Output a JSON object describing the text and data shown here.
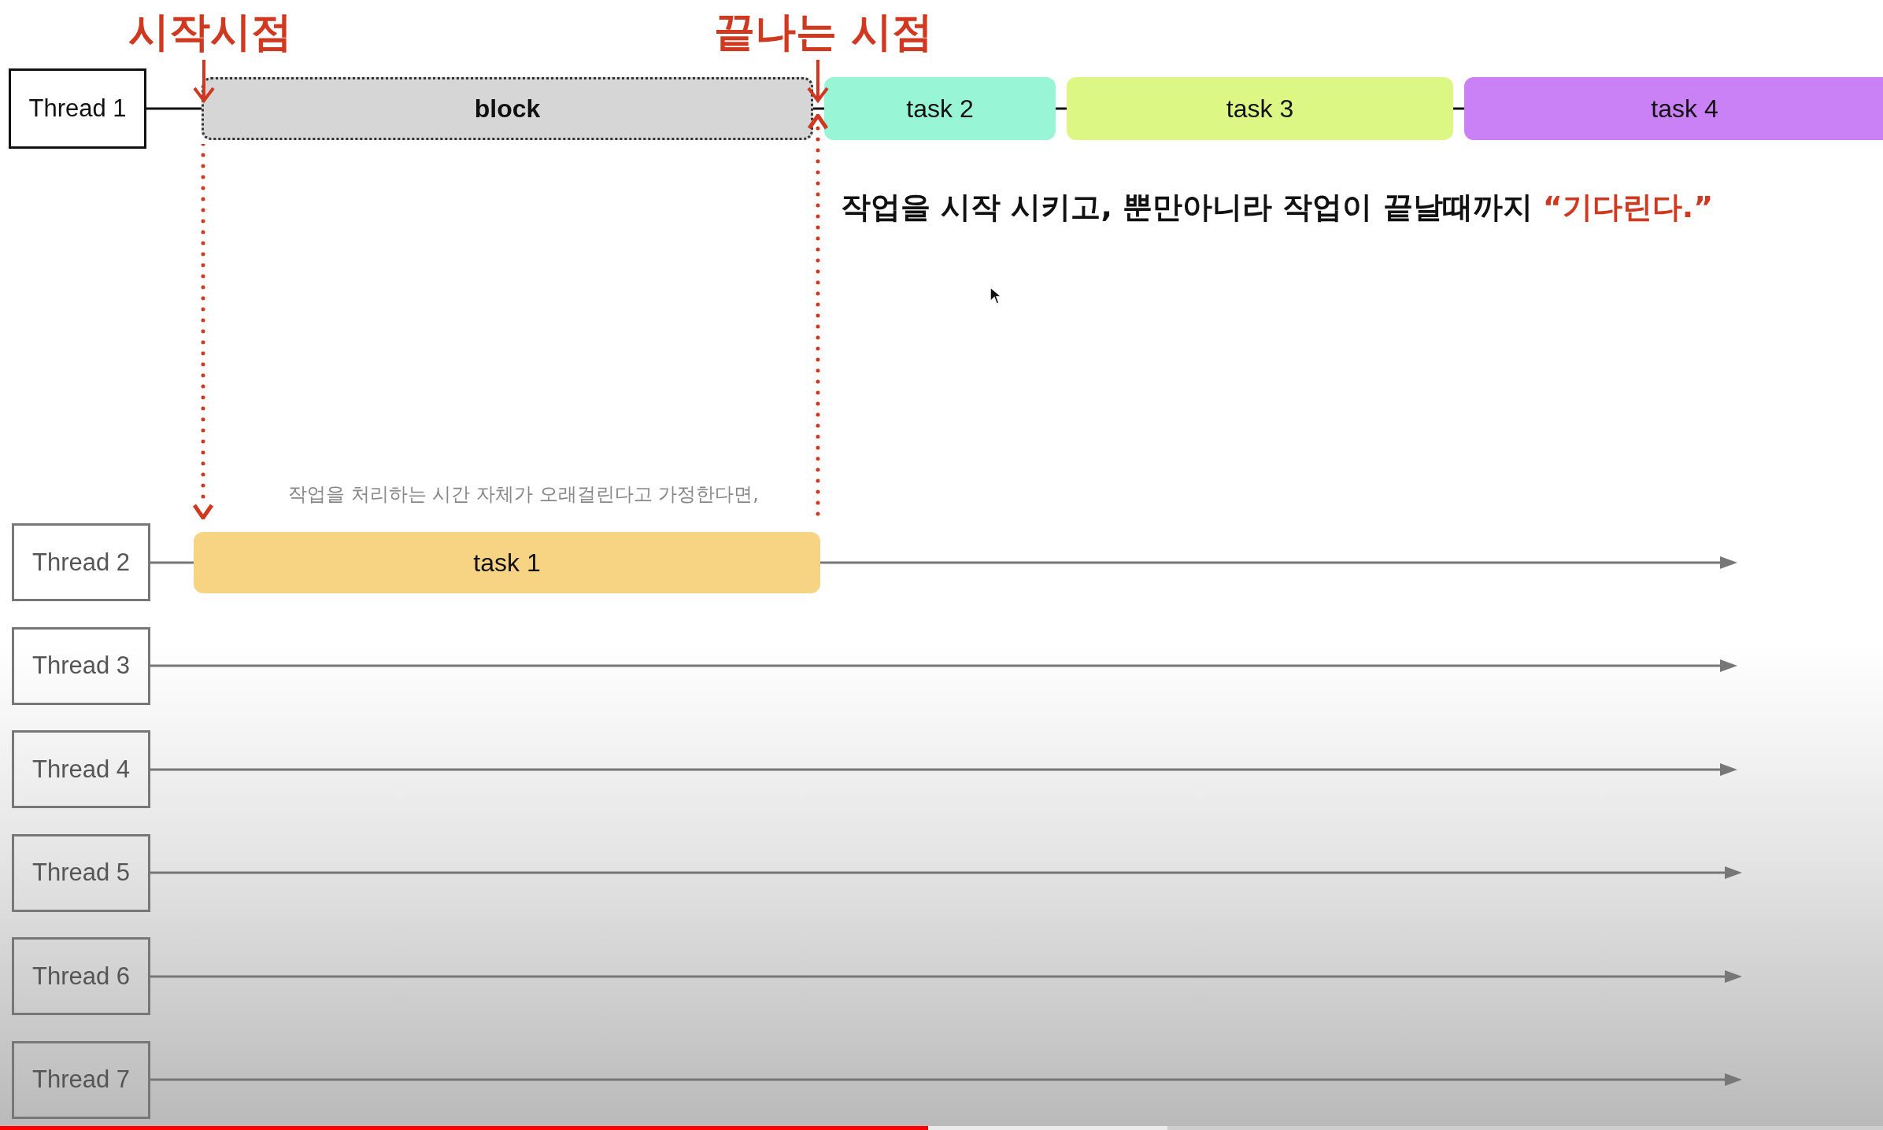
{
  "markers": [
    {
      "label": "시작시점"
    },
    {
      "label": "끝나는 시점"
    }
  ],
  "threads": [
    {
      "name": "Thread 1",
      "active": true,
      "tasks": [
        {
          "label": "block",
          "kind": "block",
          "color": "#d6d6d6"
        },
        {
          "label": "task 2",
          "kind": "task",
          "color": "#98f5d6"
        },
        {
          "label": "task 3",
          "kind": "task",
          "color": "#ddf784"
        },
        {
          "label": "task 4",
          "kind": "task",
          "color": "#c981f5"
        }
      ]
    },
    {
      "name": "Thread 2",
      "active": false,
      "tasks": [
        {
          "label": "task 1",
          "kind": "task",
          "color": "#f6d484"
        }
      ]
    },
    {
      "name": "Thread 3",
      "active": false
    },
    {
      "name": "Thread 4",
      "active": false
    },
    {
      "name": "Thread 5",
      "active": false
    },
    {
      "name": "Thread 6",
      "active": false
    },
    {
      "name": "Thread 7",
      "active": false
    }
  ],
  "message": {
    "text": "작업을 시작 시키고, 뿐만아니라 작업이 끝날때까지 ",
    "emphasis": "“기다린다.”"
  },
  "caption": "작업을 처리하는 시간 자체가 오래걸린다고 가정한다면,",
  "player": {
    "progress": {
      "level": 0.493
    },
    "buffered": {
      "level": 0.62
    }
  }
}
